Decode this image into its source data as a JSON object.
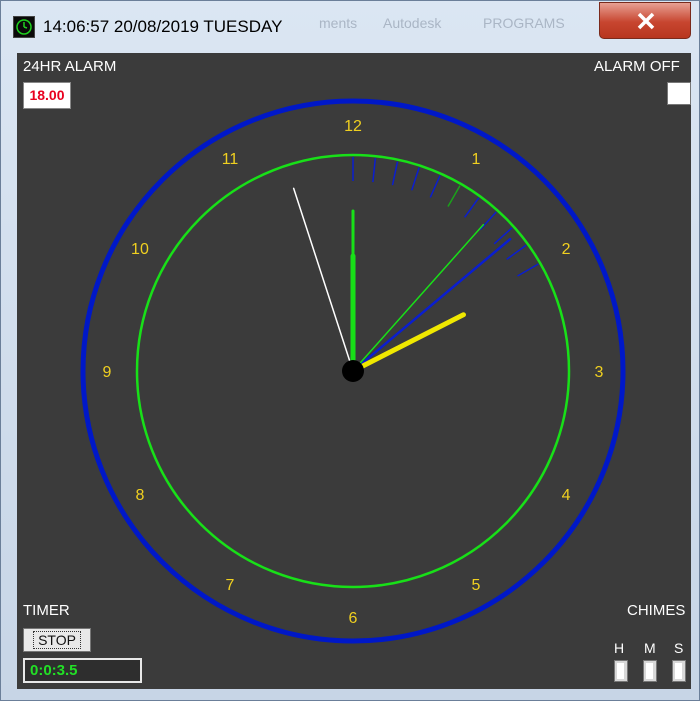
{
  "window": {
    "title": "14:06:57 20/08/2019 TUESDAY",
    "background_tabs": [
      "ments",
      "Autodesk",
      "PROGRAMS"
    ],
    "close_glyph": "close-icon"
  },
  "alarm": {
    "label": "24HR ALARM",
    "value": "18.00",
    "off_label": "ALARM OFF",
    "off_checked": false
  },
  "timer": {
    "label": "TIMER",
    "button_label": "STOP",
    "value": "0:0:3.5"
  },
  "chimes": {
    "label": "CHIMES",
    "columns": [
      "H",
      "M",
      "S"
    ]
  },
  "clock": {
    "numerals": [
      "12",
      "1",
      "2",
      "3",
      "4",
      "5",
      "6",
      "7",
      "8",
      "9",
      "10",
      "11"
    ],
    "time": {
      "hours": 14,
      "minutes": 6,
      "seconds": 57
    },
    "colors": {
      "background": "#3b3b3b",
      "outer_ring": "#0018c8",
      "inner_ring": "#18e018",
      "numerals": "#f0d020",
      "hour_hand": "#f0e800",
      "minute_hand": "#18e018",
      "second_hand": "#ffffff",
      "alarm_hand": "#0a1ed0",
      "hub": "#000000"
    }
  }
}
